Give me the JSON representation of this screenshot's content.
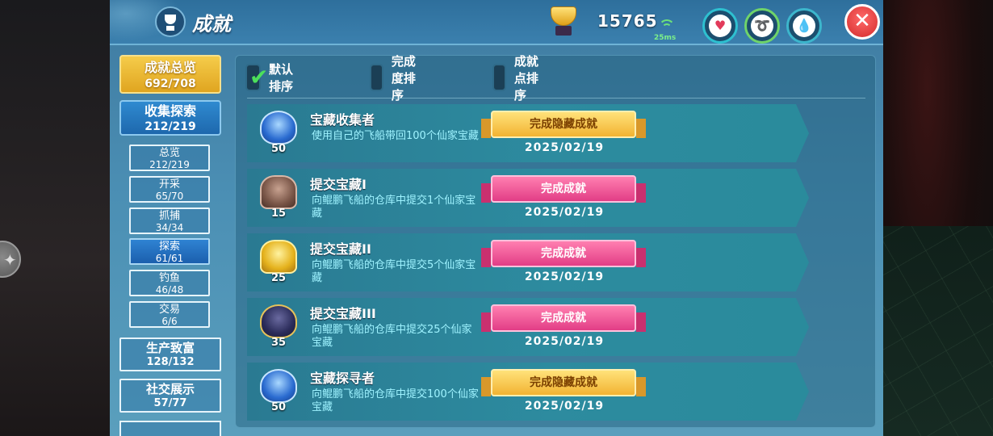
{
  "header": {
    "title": "成就",
    "score": "15765",
    "ping": "25ms"
  },
  "nav": {
    "overview": {
      "label": "成就总览",
      "count": "692/708"
    },
    "explore": {
      "label": "收集探索",
      "count": "212/219"
    },
    "sub": [
      {
        "label": "总览",
        "count": "212/219"
      },
      {
        "label": "开采",
        "count": "65/70"
      },
      {
        "label": "抓捕",
        "count": "34/34"
      },
      {
        "label": "探索",
        "count": "61/61"
      },
      {
        "label": "钓鱼",
        "count": "46/48"
      },
      {
        "label": "交易",
        "count": "6/6"
      }
    ],
    "groups": [
      {
        "label": "生产致富",
        "count": "128/132"
      },
      {
        "label": "社交展示",
        "count": "57/77"
      }
    ]
  },
  "sort": {
    "default": "默认排序",
    "completion": "完成度排序",
    "points": "成就点排序"
  },
  "achievements": [
    {
      "name": "宝藏收集者",
      "desc": "使用自己的飞船带回100个仙家宝藏",
      "points": "50",
      "status": "完成隐藏成就",
      "date": "2025/02/19",
      "medal": "blue-medal-icon",
      "ribbon_color": "#f2b332"
    },
    {
      "name": "提交宝藏I",
      "desc": "向鲲鹏飞船的仓库中提交1个仙家宝藏",
      "points": "15",
      "status": "完成成就",
      "date": "2025/02/19",
      "medal": "bronze-trophy-icon",
      "ribbon_color": "#e23d86"
    },
    {
      "name": "提交宝藏II",
      "desc": "向鲲鹏飞船的仓库中提交5个仙家宝藏",
      "points": "25",
      "status": "完成成就",
      "date": "2025/02/19",
      "medal": "gold-trophy-icon",
      "ribbon_color": "#e23d86"
    },
    {
      "name": "提交宝藏III",
      "desc": "向鲲鹏飞船的仓库中提交25个仙家宝藏",
      "points": "35",
      "status": "完成成就",
      "date": "2025/02/19",
      "medal": "dark-cup-icon",
      "ribbon_color": "#e23d86"
    },
    {
      "name": "宝藏探寻者",
      "desc": "向鲲鹏飞船的仓库中提交100个仙家宝藏",
      "points": "50",
      "status": "完成隐藏成就",
      "date": "2025/02/19",
      "medal": "blue-medal-icon",
      "ribbon_color": "#f2b332"
    }
  ]
}
